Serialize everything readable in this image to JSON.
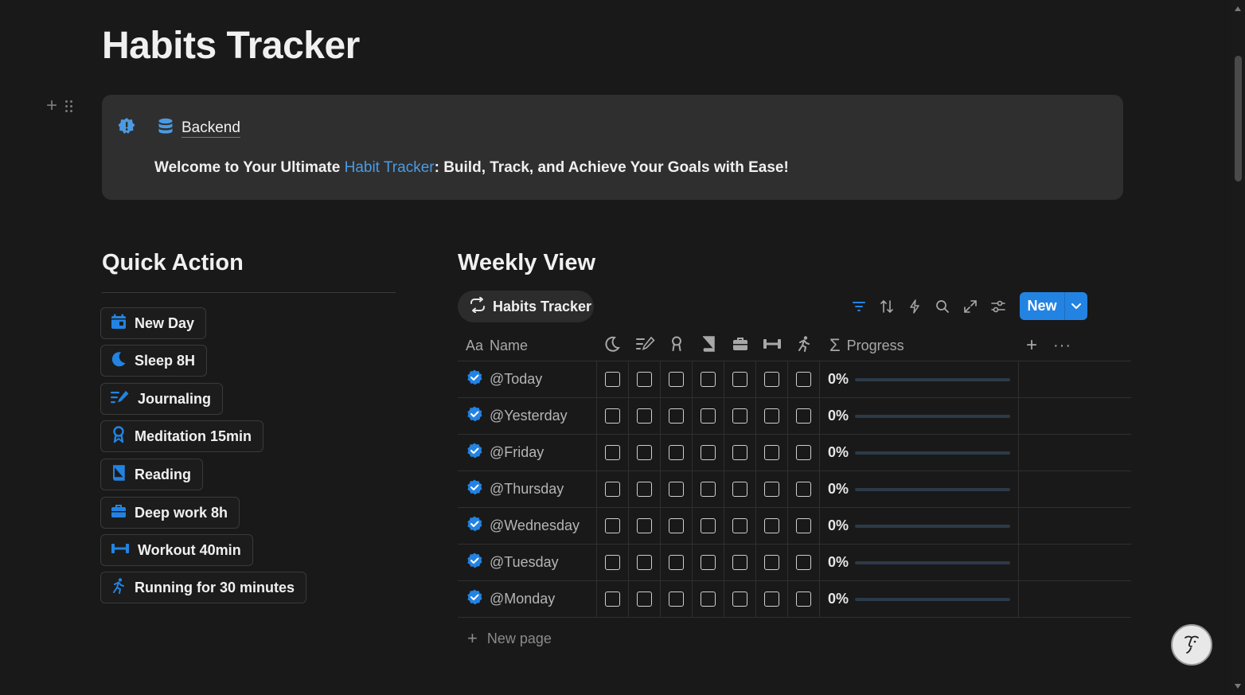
{
  "page": {
    "title": "Habits Tracker"
  },
  "callout": {
    "link_label": "Backend",
    "text_before": "Welcome to Your Ultimate ",
    "text_highlight": "Habit Tracker",
    "text_after": ": Build, Track, and Achieve Your Goals with Ease!"
  },
  "quick_action": {
    "title": "Quick Action",
    "buttons": [
      {
        "label": "New Day",
        "icon": "calendar-icon"
      },
      {
        "label": "Sleep 8H",
        "icon": "moon-icon"
      },
      {
        "label": "Journaling",
        "icon": "journal-pen-icon"
      },
      {
        "label": "Meditation 15min",
        "icon": "meditation-icon"
      },
      {
        "label": "Reading",
        "icon": "book-icon"
      },
      {
        "label": "Deep work 8h",
        "icon": "briefcase-icon"
      },
      {
        "label": "Workout 40min",
        "icon": "dumbbell-icon"
      },
      {
        "label": "Running for 30 minutes",
        "icon": "running-icon"
      }
    ]
  },
  "weekly_view": {
    "title": "Weekly View",
    "view_tab": "Habits Tracker",
    "new_button": "New",
    "columns": {
      "name_prefix": "Aa",
      "name": "Name",
      "progress": "Progress"
    },
    "rows": [
      {
        "name": "@Today",
        "progress_label": "0%",
        "progress": 0
      },
      {
        "name": "@Yesterday",
        "progress_label": "0%",
        "progress": 0
      },
      {
        "name": "@Friday",
        "progress_label": "0%",
        "progress": 0
      },
      {
        "name": "@Thursday",
        "progress_label": "0%",
        "progress": 0
      },
      {
        "name": "@Wednesday",
        "progress_label": "0%",
        "progress": 0
      },
      {
        "name": "@Tuesday",
        "progress_label": "0%",
        "progress": 0
      },
      {
        "name": "@Monday",
        "progress_label": "0%",
        "progress": 0
      }
    ],
    "new_page": "New page"
  },
  "colors": {
    "accent": "#2383e2",
    "background": "#191919",
    "callout_bg": "#2f2f2f",
    "link_blue": "#4b9be3"
  }
}
